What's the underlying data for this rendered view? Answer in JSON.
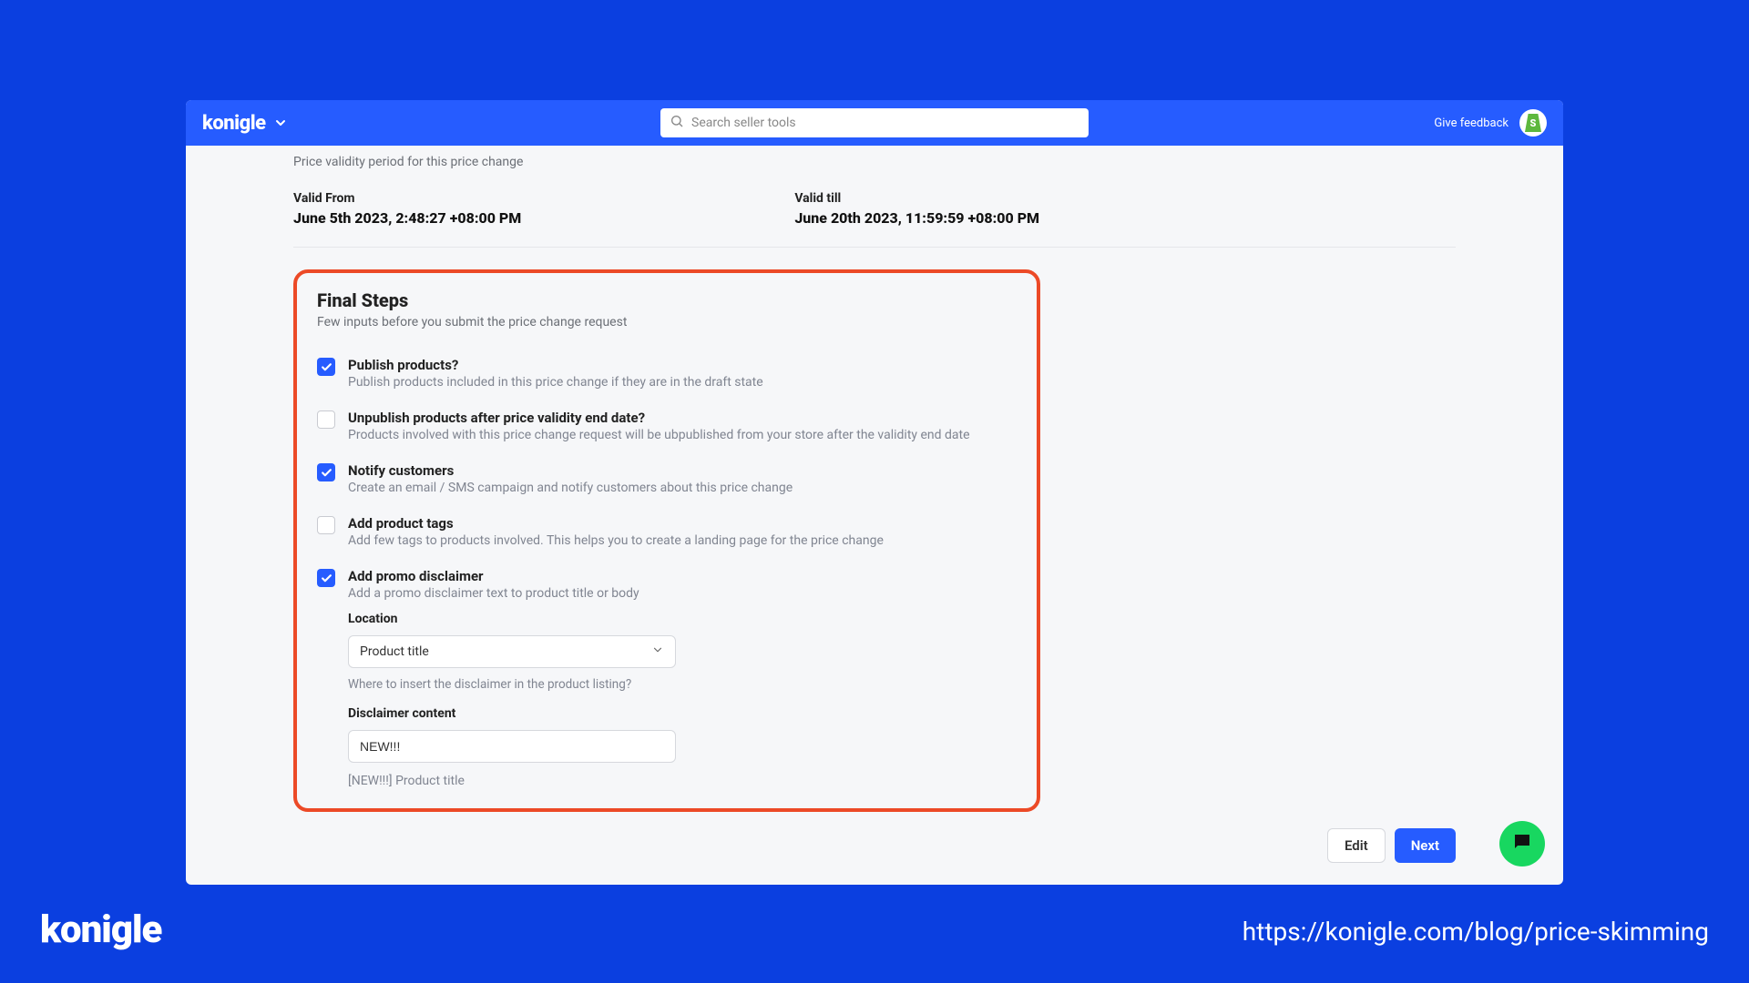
{
  "header": {
    "brand": "konigle",
    "search_placeholder": "Search seller tools",
    "feedback": "Give feedback"
  },
  "validity": {
    "description": "Price validity period for this price change",
    "from_label": "Valid From",
    "from_value": "June 5th 2023, 2:48:27 +08:00 PM",
    "till_label": "Valid till",
    "till_value": "June 20th 2023, 11:59:59 +08:00 PM"
  },
  "final": {
    "title": "Final Steps",
    "subtitle": "Few inputs before you submit the price change request",
    "options": [
      {
        "checked": true,
        "title": "Publish products?",
        "desc": "Publish products included in this price change if they are in the draft state"
      },
      {
        "checked": false,
        "title": "Unpublish products after price validity end date?",
        "desc": "Products involved with this price change request will be ubpublished from your store after the validity end date"
      },
      {
        "checked": true,
        "title": "Notify customers",
        "desc": "Create an email / SMS campaign and notify customers about this price change"
      },
      {
        "checked": false,
        "title": "Add product tags",
        "desc": "Add few tags to products involved. This helps you to create a landing page for the price change"
      },
      {
        "checked": true,
        "title": "Add promo disclaimer",
        "desc": "Add a promo disclaimer text to product title or body"
      }
    ],
    "location_label": "Location",
    "location_value": "Product title",
    "location_hint": "Where to insert the disclaimer in the product listing?",
    "disclaimer_label": "Disclaimer content",
    "disclaimer_value": "NEW!!!",
    "disclaimer_preview": "[NEW!!!] Product title"
  },
  "actions": {
    "edit": "Edit",
    "next": "Next"
  },
  "overlay": {
    "brand": "konigle",
    "url": "https://konigle.com/blog/price-skimming"
  },
  "colors": {
    "accent": "#265cff",
    "highlight_border": "#ec4a27",
    "fab": "#18d760"
  }
}
